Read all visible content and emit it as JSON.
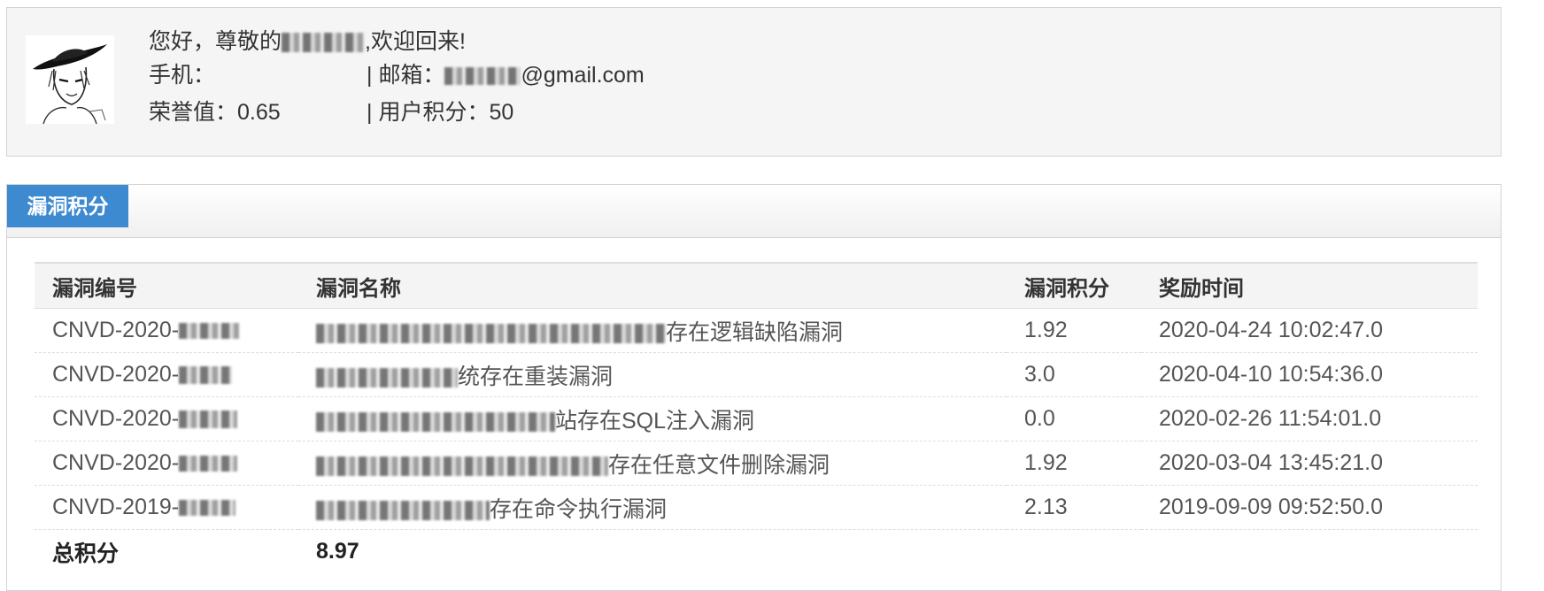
{
  "user": {
    "greeting_prefix": "您好，尊敬的",
    "greeting_suffix": ",欢迎回来!",
    "phone_label": "手机：",
    "email_label": "| 邮箱：",
    "email_suffix": "@gmail.com",
    "honor_label": "荣誉值：",
    "honor_value": "0.65",
    "points_label": "| 用户积分：",
    "points_value": "50"
  },
  "score_panel": {
    "tab_label": "漏洞积分",
    "columns": [
      "漏洞编号",
      "漏洞名称",
      "漏洞积分",
      "奖励时间"
    ],
    "rows": [
      {
        "id": "CNVD-2020-",
        "name": "存在逻辑缺陷漏洞",
        "score": "1.92",
        "time": "2020-04-24 10:02:47.0"
      },
      {
        "id": "CNVD-2020-",
        "name": "统存在重装漏洞",
        "score": "3.0",
        "time": "2020-04-10 10:54:36.0"
      },
      {
        "id": "CNVD-2020-",
        "name": "站存在SQL注入漏洞",
        "score": "0.0",
        "time": "2020-02-26 11:54:01.0"
      },
      {
        "id": "CNVD-2020-",
        "name": "存在任意文件删除漏洞",
        "score": "1.92",
        "time": "2020-03-04 13:45:21.0"
      },
      {
        "id": "CNVD-2019-",
        "name": "存在命令执行漏洞",
        "score": "2.13",
        "time": "2019-09-09 09:52:50.0"
      }
    ],
    "total_label": "总积分",
    "total_value": "8.97"
  },
  "colors": {
    "tab_bg": "#3d8ad0",
    "panel_bg": "#f5f5f5",
    "border": "#d4d4d4"
  }
}
